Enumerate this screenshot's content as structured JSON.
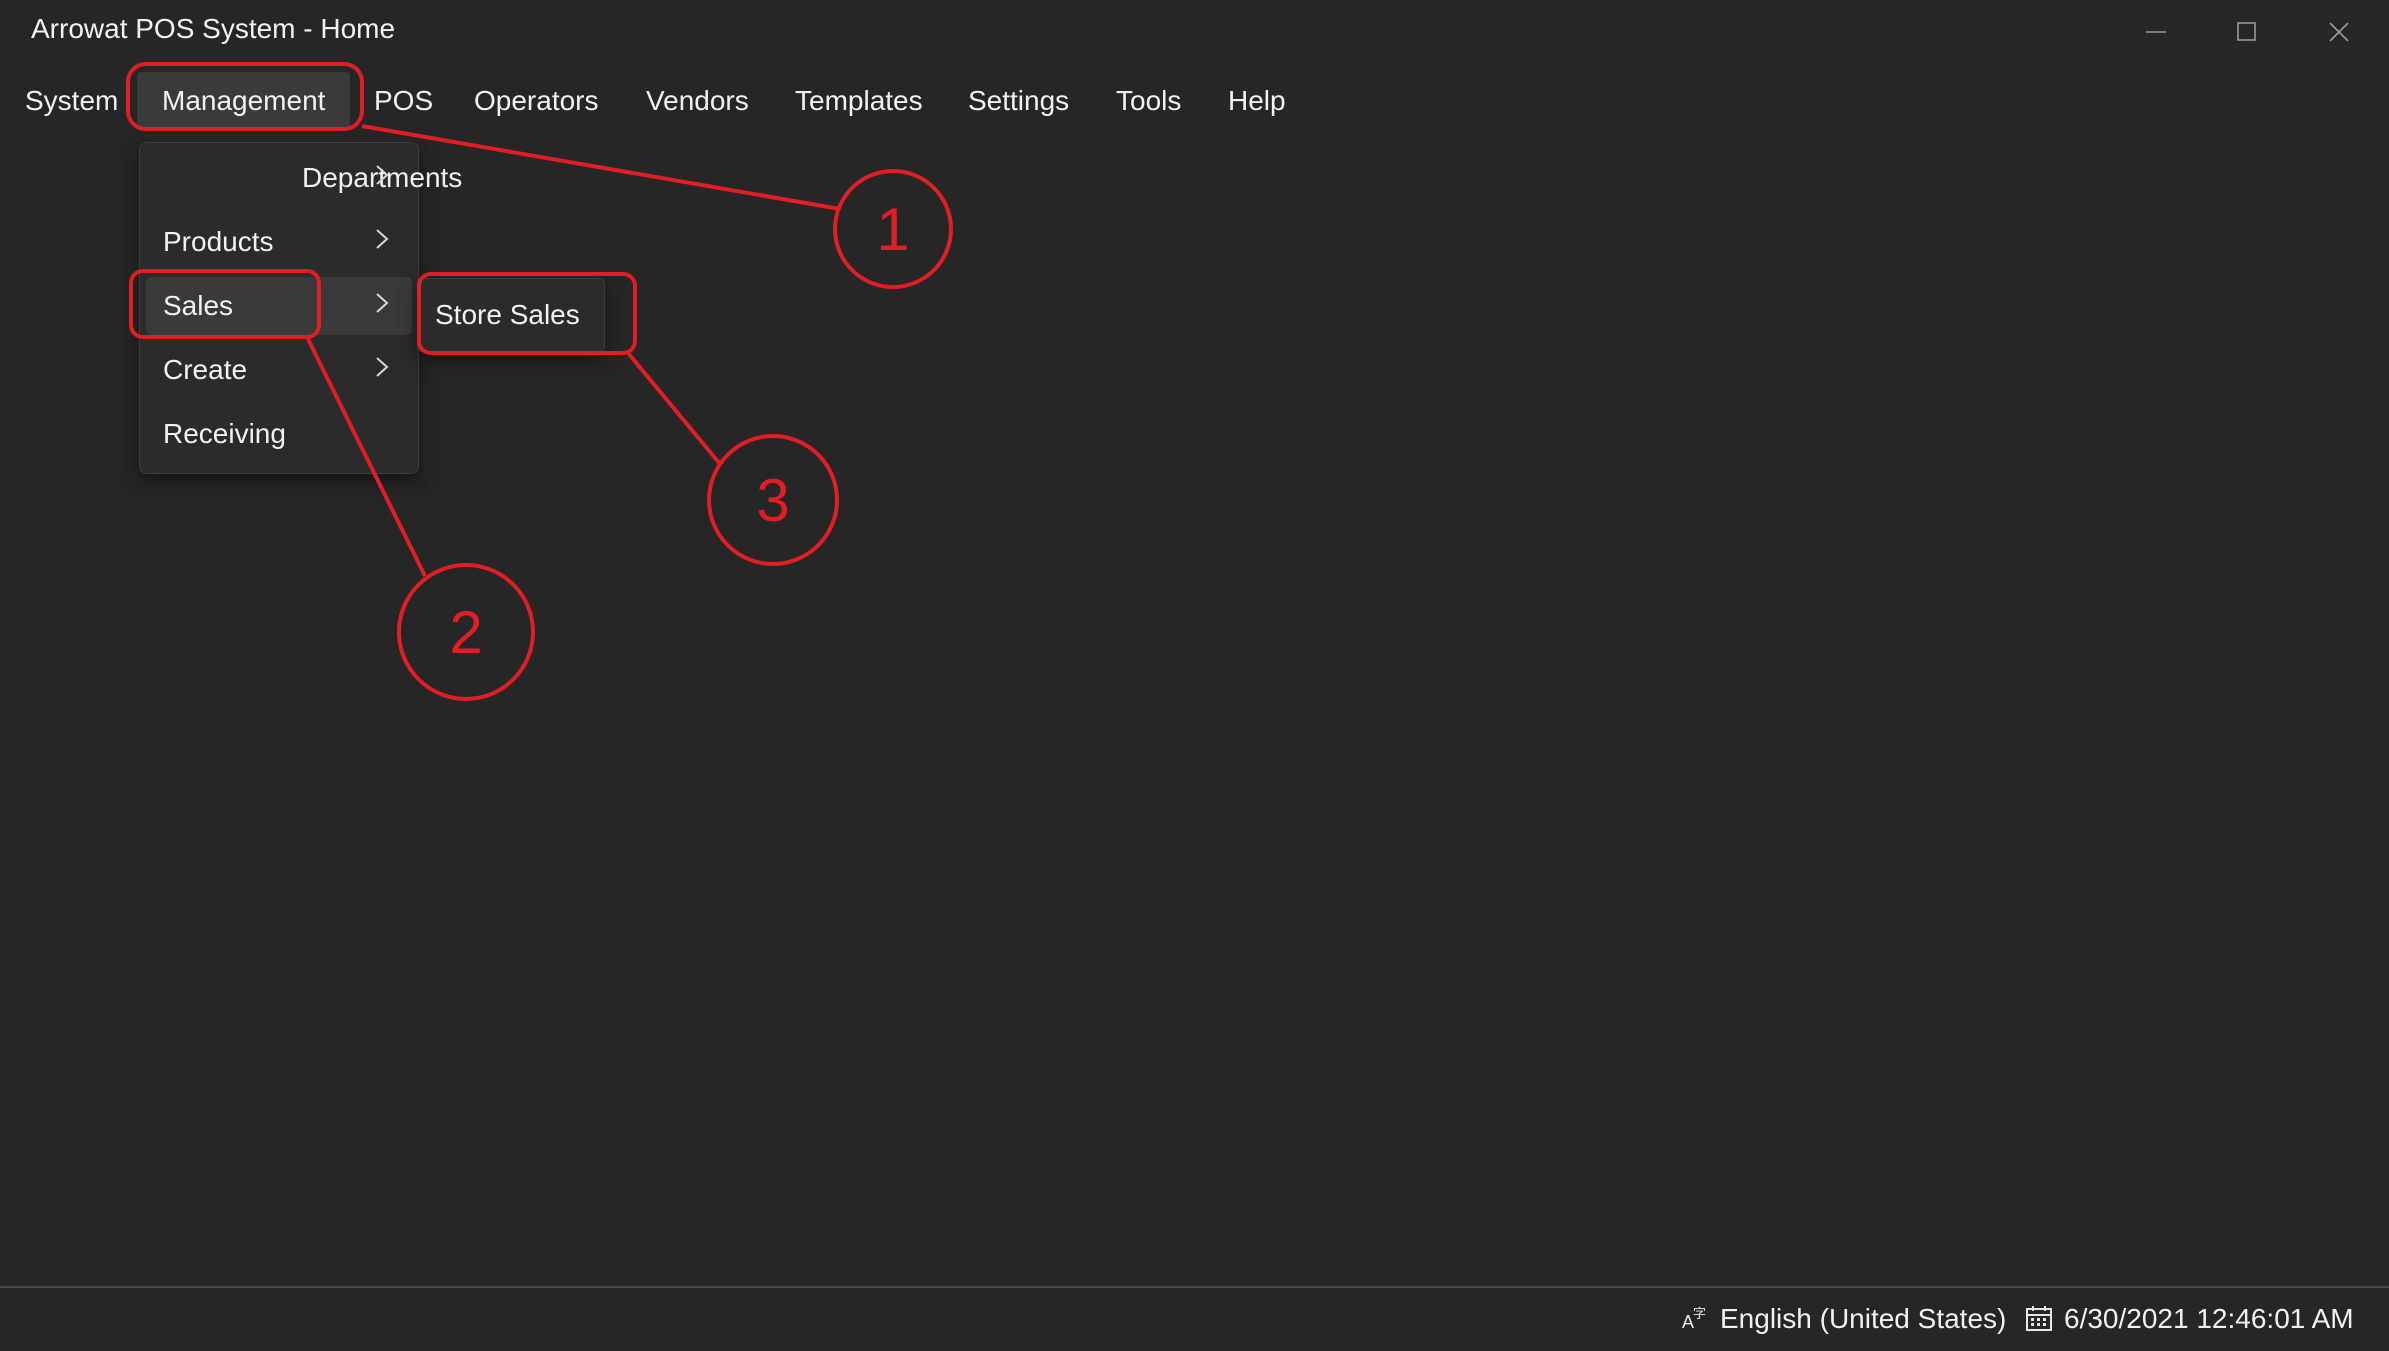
{
  "window": {
    "title": "Arrowat POS System - Home",
    "controls": [
      "minimize",
      "maximize",
      "close"
    ]
  },
  "menubar": {
    "items": [
      {
        "label": "System"
      },
      {
        "label": "Management"
      },
      {
        "label": "POS"
      },
      {
        "label": "Operators"
      },
      {
        "label": "Vendors"
      },
      {
        "label": "Templates"
      },
      {
        "label": "Settings"
      },
      {
        "label": "Tools"
      },
      {
        "label": "Help"
      }
    ],
    "active": "Management"
  },
  "management_menu": {
    "items": [
      {
        "label": "Departments",
        "has_submenu": true
      },
      {
        "label": "Products",
        "has_submenu": true
      },
      {
        "label": "Sales",
        "has_submenu": true
      },
      {
        "label": "Create",
        "has_submenu": true
      },
      {
        "label": "Receiving",
        "has_submenu": false
      }
    ],
    "active": "Sales"
  },
  "sales_submenu": {
    "items": [
      {
        "label": "Store Sales"
      }
    ]
  },
  "statusbar": {
    "language": "English (United States)",
    "datetime": "6/30/2021 12:46:01 AM"
  },
  "annotations": {
    "color": "#e01e26",
    "callouts": [
      "1",
      "2",
      "3"
    ]
  }
}
